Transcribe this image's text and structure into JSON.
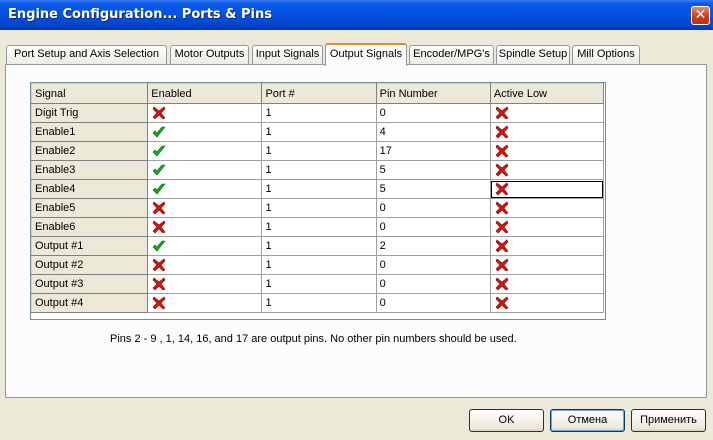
{
  "window": {
    "title": "Engine Configuration... Ports & Pins",
    "close_symbol": "✕"
  },
  "tabs": [
    {
      "label": "Port Setup and Axis Selection"
    },
    {
      "label": "Motor Outputs"
    },
    {
      "label": "Input Signals"
    },
    {
      "label": "Output Signals"
    },
    {
      "label": "Encoder/MPG's"
    },
    {
      "label": "Spindle Setup"
    },
    {
      "label": "Mill Options"
    }
  ],
  "active_tab": "Output Signals",
  "table": {
    "columns": [
      "Signal",
      "Enabled",
      "Port #",
      "Pin Number",
      "Active Low"
    ],
    "rows": [
      {
        "signal": "Digit  Trig",
        "enabled": "x-icon",
        "port": "1",
        "pin": "0",
        "active_low": "x-icon"
      },
      {
        "signal": "Enable1",
        "enabled": "check-icon",
        "port": "1",
        "pin": "4",
        "active_low": "x-icon"
      },
      {
        "signal": "Enable2",
        "enabled": "check-icon",
        "port": "1",
        "pin": "17",
        "active_low": "x-icon"
      },
      {
        "signal": "Enable3",
        "enabled": "check-icon",
        "port": "1",
        "pin": "5",
        "active_low": "x-icon"
      },
      {
        "signal": "Enable4",
        "enabled": "check-icon",
        "port": "1",
        "pin": "5",
        "active_low": "x-icon"
      },
      {
        "signal": "Enable5",
        "enabled": "x-icon",
        "port": "1",
        "pin": "0",
        "active_low": "x-icon"
      },
      {
        "signal": "Enable6",
        "enabled": "x-icon",
        "port": "1",
        "pin": "0",
        "active_low": "x-icon"
      },
      {
        "signal": "Output #1",
        "enabled": "check-icon",
        "port": "1",
        "pin": "2",
        "active_low": "x-icon"
      },
      {
        "signal": "Output #2",
        "enabled": "x-icon",
        "port": "1",
        "pin": "0",
        "active_low": "x-icon"
      },
      {
        "signal": "Output #3",
        "enabled": "x-icon",
        "port": "1",
        "pin": "0",
        "active_low": "x-icon"
      },
      {
        "signal": "Output #4",
        "enabled": "x-icon",
        "port": "1",
        "pin": "0",
        "active_low": "x-icon"
      }
    ]
  },
  "note": "Pins 2 - 9 , 1, 14, 16, and 17 are output pins.  No  other pin numbers should be used.",
  "buttons": {
    "ok": "OK",
    "cancel": "Отмена",
    "apply": "Применить"
  },
  "colors": {
    "titlebar": "#0552df",
    "check_icon": "#19a81e",
    "x_icon": "#d0180f",
    "active_tab_accent": "#e68b2c"
  }
}
